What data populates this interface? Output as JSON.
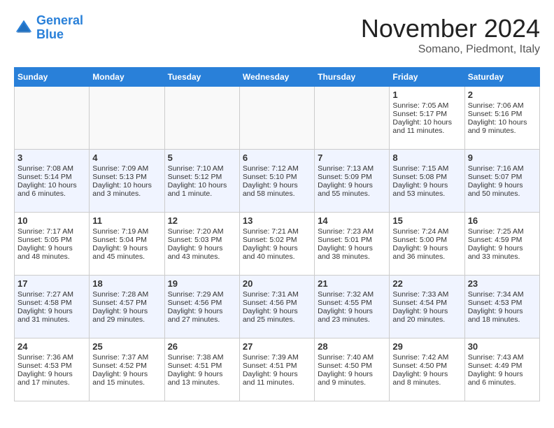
{
  "logo": {
    "line1": "General",
    "line2": "Blue"
  },
  "title": "November 2024",
  "location": "Somano, Piedmont, Italy",
  "days_of_week": [
    "Sunday",
    "Monday",
    "Tuesday",
    "Wednesday",
    "Thursday",
    "Friday",
    "Saturday"
  ],
  "weeks": [
    [
      {
        "day": "",
        "content": ""
      },
      {
        "day": "",
        "content": ""
      },
      {
        "day": "",
        "content": ""
      },
      {
        "day": "",
        "content": ""
      },
      {
        "day": "",
        "content": ""
      },
      {
        "day": "1",
        "content": "Sunrise: 7:05 AM\nSunset: 5:17 PM\nDaylight: 10 hours and 11 minutes."
      },
      {
        "day": "2",
        "content": "Sunrise: 7:06 AM\nSunset: 5:16 PM\nDaylight: 10 hours and 9 minutes."
      }
    ],
    [
      {
        "day": "3",
        "content": "Sunrise: 7:08 AM\nSunset: 5:14 PM\nDaylight: 10 hours and 6 minutes."
      },
      {
        "day": "4",
        "content": "Sunrise: 7:09 AM\nSunset: 5:13 PM\nDaylight: 10 hours and 3 minutes."
      },
      {
        "day": "5",
        "content": "Sunrise: 7:10 AM\nSunset: 5:12 PM\nDaylight: 10 hours and 1 minute."
      },
      {
        "day": "6",
        "content": "Sunrise: 7:12 AM\nSunset: 5:10 PM\nDaylight: 9 hours and 58 minutes."
      },
      {
        "day": "7",
        "content": "Sunrise: 7:13 AM\nSunset: 5:09 PM\nDaylight: 9 hours and 55 minutes."
      },
      {
        "day": "8",
        "content": "Sunrise: 7:15 AM\nSunset: 5:08 PM\nDaylight: 9 hours and 53 minutes."
      },
      {
        "day": "9",
        "content": "Sunrise: 7:16 AM\nSunset: 5:07 PM\nDaylight: 9 hours and 50 minutes."
      }
    ],
    [
      {
        "day": "10",
        "content": "Sunrise: 7:17 AM\nSunset: 5:05 PM\nDaylight: 9 hours and 48 minutes."
      },
      {
        "day": "11",
        "content": "Sunrise: 7:19 AM\nSunset: 5:04 PM\nDaylight: 9 hours and 45 minutes."
      },
      {
        "day": "12",
        "content": "Sunrise: 7:20 AM\nSunset: 5:03 PM\nDaylight: 9 hours and 43 minutes."
      },
      {
        "day": "13",
        "content": "Sunrise: 7:21 AM\nSunset: 5:02 PM\nDaylight: 9 hours and 40 minutes."
      },
      {
        "day": "14",
        "content": "Sunrise: 7:23 AM\nSunset: 5:01 PM\nDaylight: 9 hours and 38 minutes."
      },
      {
        "day": "15",
        "content": "Sunrise: 7:24 AM\nSunset: 5:00 PM\nDaylight: 9 hours and 36 minutes."
      },
      {
        "day": "16",
        "content": "Sunrise: 7:25 AM\nSunset: 4:59 PM\nDaylight: 9 hours and 33 minutes."
      }
    ],
    [
      {
        "day": "17",
        "content": "Sunrise: 7:27 AM\nSunset: 4:58 PM\nDaylight: 9 hours and 31 minutes."
      },
      {
        "day": "18",
        "content": "Sunrise: 7:28 AM\nSunset: 4:57 PM\nDaylight: 9 hours and 29 minutes."
      },
      {
        "day": "19",
        "content": "Sunrise: 7:29 AM\nSunset: 4:56 PM\nDaylight: 9 hours and 27 minutes."
      },
      {
        "day": "20",
        "content": "Sunrise: 7:31 AM\nSunset: 4:56 PM\nDaylight: 9 hours and 25 minutes."
      },
      {
        "day": "21",
        "content": "Sunrise: 7:32 AM\nSunset: 4:55 PM\nDaylight: 9 hours and 23 minutes."
      },
      {
        "day": "22",
        "content": "Sunrise: 7:33 AM\nSunset: 4:54 PM\nDaylight: 9 hours and 20 minutes."
      },
      {
        "day": "23",
        "content": "Sunrise: 7:34 AM\nSunset: 4:53 PM\nDaylight: 9 hours and 18 minutes."
      }
    ],
    [
      {
        "day": "24",
        "content": "Sunrise: 7:36 AM\nSunset: 4:53 PM\nDaylight: 9 hours and 17 minutes."
      },
      {
        "day": "25",
        "content": "Sunrise: 7:37 AM\nSunset: 4:52 PM\nDaylight: 9 hours and 15 minutes."
      },
      {
        "day": "26",
        "content": "Sunrise: 7:38 AM\nSunset: 4:51 PM\nDaylight: 9 hours and 13 minutes."
      },
      {
        "day": "27",
        "content": "Sunrise: 7:39 AM\nSunset: 4:51 PM\nDaylight: 9 hours and 11 minutes."
      },
      {
        "day": "28",
        "content": "Sunrise: 7:40 AM\nSunset: 4:50 PM\nDaylight: 9 hours and 9 minutes."
      },
      {
        "day": "29",
        "content": "Sunrise: 7:42 AM\nSunset: 4:50 PM\nDaylight: 9 hours and 8 minutes."
      },
      {
        "day": "30",
        "content": "Sunrise: 7:43 AM\nSunset: 4:49 PM\nDaylight: 9 hours and 6 minutes."
      }
    ]
  ]
}
